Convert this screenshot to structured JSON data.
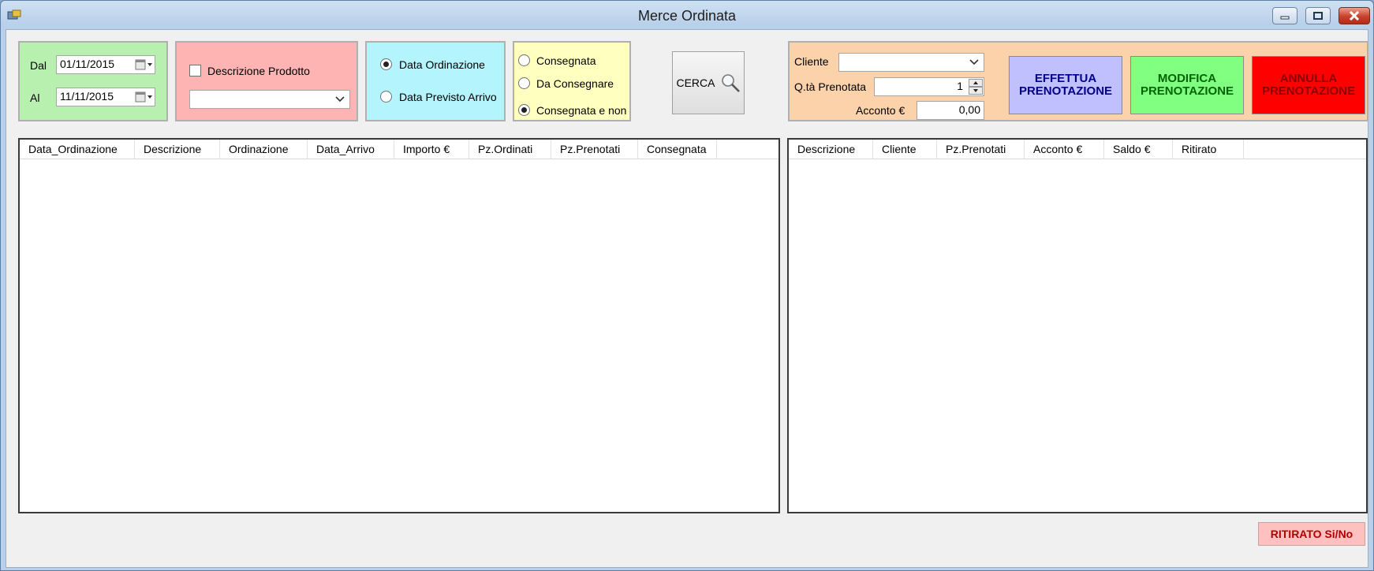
{
  "window": {
    "title": "Merce Ordinata",
    "controls": [
      "minimize",
      "maximize",
      "close"
    ]
  },
  "date_panel": {
    "from_label": "Dal",
    "from_value": "01/11/2015",
    "to_label": "Al",
    "to_value": "11/11/2015"
  },
  "product_panel": {
    "checkbox_label": "Descrizione Prodotto",
    "checked": false,
    "combo_value": ""
  },
  "date_type_panel": {
    "options": [
      "Data Ordinazione",
      "Data Previsto Arrivo"
    ],
    "selected": "Data Ordinazione"
  },
  "delivery_panel": {
    "options": [
      "Consegnata",
      "Da Consegnare",
      "Consegnata e non"
    ],
    "selected": "Consegnata e non"
  },
  "search_button": {
    "label": "CERCA"
  },
  "booking_panel": {
    "client_label": "Cliente",
    "client_value": "",
    "qty_label": "Q.tà Prenotata",
    "qty_value": "1",
    "deposit_label": "Acconto €",
    "deposit_value": "0,00"
  },
  "action_buttons": {
    "book": "EFFETTUA PRENOTAZIONE",
    "edit": "MODIFICA PRENOTAZIONE",
    "cancel": "ANNULLA PRENOTAZIONE"
  },
  "orders_grid": {
    "columns": [
      "Data_Ordinazione",
      "Descrizione",
      "Ordinazione",
      "Data_Arrivo",
      "Importo €",
      "Pz.Ordinati",
      "Pz.Prenotati",
      "Consegnata"
    ],
    "rows": []
  },
  "bookings_grid": {
    "columns": [
      "Descrizione",
      "Cliente",
      "Pz.Prenotati",
      "Acconto €",
      "Saldo €",
      "Ritirato"
    ],
    "rows": []
  },
  "withdrawn_button": {
    "label": "RITIRATO Si/No"
  },
  "colors": {
    "date_panel_bg": "#b8f0b0",
    "product_panel_bg": "#ffb4b4",
    "date_type_panel_bg": "#b4f4fc",
    "delivery_panel_bg": "#ffffc0",
    "booking_panel_bg": "#fcd2aa",
    "book_button_bg": "#c0c0ff",
    "book_button_text": "#00008b",
    "edit_button_bg": "#80ff80",
    "edit_button_text": "#006400",
    "cancel_button_bg": "#ff0000",
    "cancel_button_text": "#8b0000",
    "withdrawn_button_bg": "#ffc0c0",
    "withdrawn_button_text": "#b00000"
  }
}
